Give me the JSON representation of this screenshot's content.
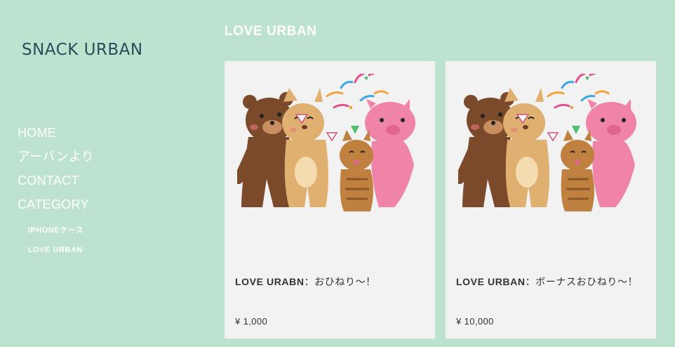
{
  "site": {
    "logo": "SNACK URBAN"
  },
  "nav": {
    "items": [
      "HOME",
      "アーバンより",
      "CONTACT",
      "CATEGORY"
    ],
    "sub_items": [
      "IPHONEケース",
      "LOVE URBAN"
    ]
  },
  "section": {
    "title": "LOVE URBAN"
  },
  "products": [
    {
      "name_bold": "LOVE URABN",
      "name_rest": "：おひねり〜！",
      "price": "¥ 1,000"
    },
    {
      "name_bold": "LOVE URBAN",
      "name_rest": "：ボーナスおひねり〜！",
      "price": "¥ 10,000"
    }
  ],
  "colors": {
    "background": "#bde3d0",
    "card": "#f2f2f2",
    "logo": "#2d4a58"
  }
}
